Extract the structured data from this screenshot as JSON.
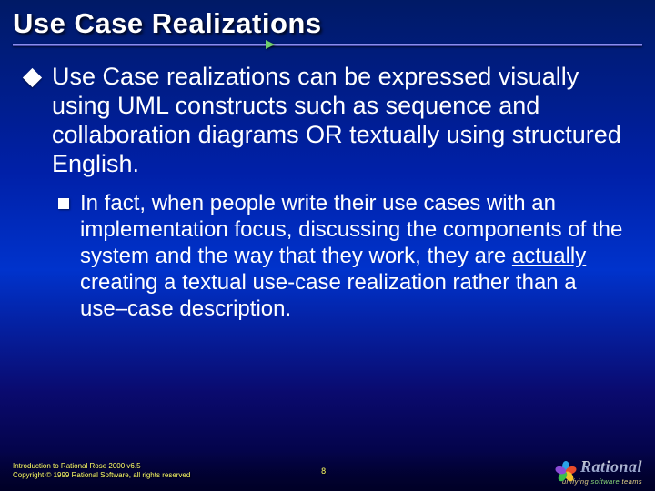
{
  "slide": {
    "title": "Use Case Realizations",
    "bullet1": "Use Case realizations can be expressed visually using UML constructs such as sequence and collaboration diagrams OR textually using structured English.",
    "sub1_pre": "In fact, when people write their use cases with an implementation focus, discussing the components of the system and the way that they work, they are ",
    "sub1_underlined": "actually",
    "sub1_post": " creating a textual use-case realization rather than a use–case description."
  },
  "footer": {
    "line1": "Introduction to Rational Rose 2000 v6.5",
    "line2": "Copyright © 1999 Rational Software, all rights reserved",
    "page_number": "8",
    "brand": "Rational",
    "tagline_pre": "unifying ",
    "tagline_mid": "software",
    "tagline_post": " teams"
  }
}
